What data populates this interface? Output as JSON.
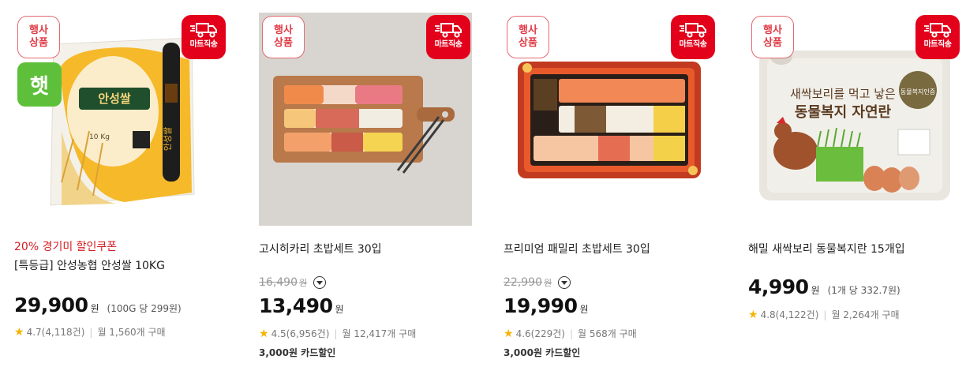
{
  "products": [
    {
      "event_badge": "행사\n상품",
      "ship_badge": "마트직송",
      "new_badge": "햇",
      "promo": "20% 경기미 할인쿠폰",
      "name": "[특등급] 안성농협 안성쌀 10KG",
      "price": "29,900",
      "won": "원",
      "unit_price": "(100G 당 299원)",
      "rating": "4.7(4,118건)",
      "monthly": "월 1,560개 구매",
      "package_text": "안성쌀",
      "package_sub": "10 Kg"
    },
    {
      "event_badge": "행사\n상품",
      "ship_badge": "마트직송",
      "name": "고시히카리 초밥세트 30입",
      "original_price": "16,490",
      "orig_won": "원",
      "price": "13,490",
      "won": "원",
      "rating": "4.5(6,956건)",
      "monthly": "월 12,417개 구매",
      "card_discount": "3,000원 카드할인"
    },
    {
      "event_badge": "행사\n상품",
      "ship_badge": "마트직송",
      "name": "프리미엄 패밀리 초밥세트 30입",
      "original_price": "22,990",
      "orig_won": "원",
      "price": "19,990",
      "won": "원",
      "rating": "4.6(229건)",
      "monthly": "월 568개 구매",
      "card_discount": "3,000원 카드할인"
    },
    {
      "event_badge": "행사\n상품",
      "ship_badge": "마트직송",
      "name": "해밀 새싹보리 동물복지란 15개입",
      "price": "4,990",
      "won": "원",
      "unit_price": "(1개 당 332.7원)",
      "rating": "4.8(4,122건)",
      "monthly": "월 2,264개 구매",
      "package_title": "새싹보리를 먹고 낳은",
      "package_title2": "동물복지 자연란",
      "package_label": "동물복지인증"
    }
  ],
  "colors": {
    "event_badge_border": "#e46a6f",
    "event_badge_text": "#e03b45",
    "ship_badge_bg": "#e2001b",
    "promo_text": "#d41c23",
    "new_badge_bg": "#5ec03a",
    "star": "#f5b400"
  },
  "icons": {
    "ship_badge": "delivery-truck-icon",
    "rating": "star-icon",
    "original_price_toggle": "chevron-down-icon"
  }
}
